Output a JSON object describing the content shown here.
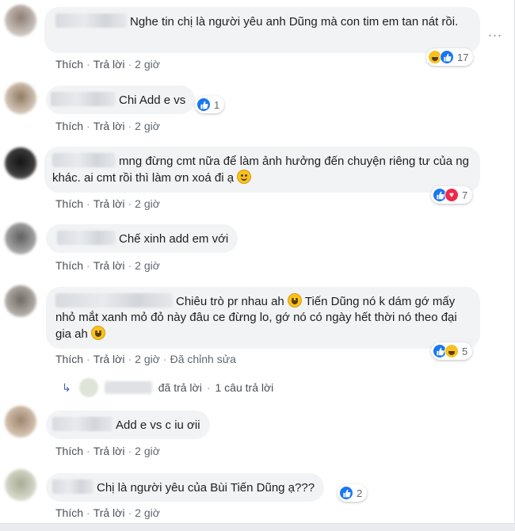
{
  "comments": [
    {
      "text": "Nghe tin chị là người yêu anh Dũng mà con tim em tan nát rồi.",
      "actions": {
        "like": "Thích",
        "reply": "Trả lời",
        "time": "2 giờ"
      },
      "reaction_count": "17",
      "reactions": [
        "haha-icon",
        "like-icon"
      ],
      "avatar_color": "#b9ada6"
    },
    {
      "text": "Chi Add e vs",
      "actions": {
        "like": "Thích",
        "reply": "Trả lời",
        "time": "2 giờ"
      },
      "reaction_count": "1",
      "reactions": [
        "like-icon"
      ],
      "avatar_color": "#b8a795"
    },
    {
      "text": "mng đừng cmt nữa để làm ảnh hưởng đến chuyện riêng tư của ng khác. ai cmt rồi thì làm ơn xoá đi ạ",
      "actions": {
        "like": "Thích",
        "reply": "Trả lời",
        "time": "2 giờ"
      },
      "reaction_count": "7",
      "reactions": [
        "like-icon",
        "love-icon"
      ],
      "avatar_color": "#2a2a2a"
    },
    {
      "text": "Chế xinh add em với",
      "actions": {
        "like": "Thích",
        "reply": "Trả lời",
        "time": "2 giờ"
      },
      "avatar_color": "#8c8c8c"
    },
    {
      "text_parts": [
        "Chiêu trò pr nhau ah",
        "Tiến Dũng nó k dám gớ mấy nhỏ mắt xanh mỏ đỏ này đâu ce đừng lo, gớ nó có ngày hết thời nó theo đại gia ah"
      ],
      "actions": {
        "like": "Thích",
        "reply": "Trả lời",
        "time": "2 giờ",
        "edited": "Đã chỉnh sửa"
      },
      "reaction_count": "5",
      "reactions": [
        "like-icon",
        "haha-icon"
      ],
      "avatar_color": "#9a958f",
      "replies": {
        "replied": "đã trả lời",
        "count": "1 câu trả lời"
      }
    },
    {
      "text": "Add e vs c iu ơii",
      "actions": {
        "like": "Thích",
        "reply": "Trả lời",
        "time": "2 giờ"
      },
      "avatar_color": "#c2aa94"
    },
    {
      "text": "Chị là người yêu của Bùi Tiến Dũng ạ???",
      "actions": {
        "like": "Thích",
        "reply": "Trả lời",
        "time": "2 giờ"
      },
      "reaction_count": "2",
      "reactions": [
        "like-icon"
      ],
      "avatar_color": "#c9cbbb"
    }
  ],
  "more_label": "..."
}
